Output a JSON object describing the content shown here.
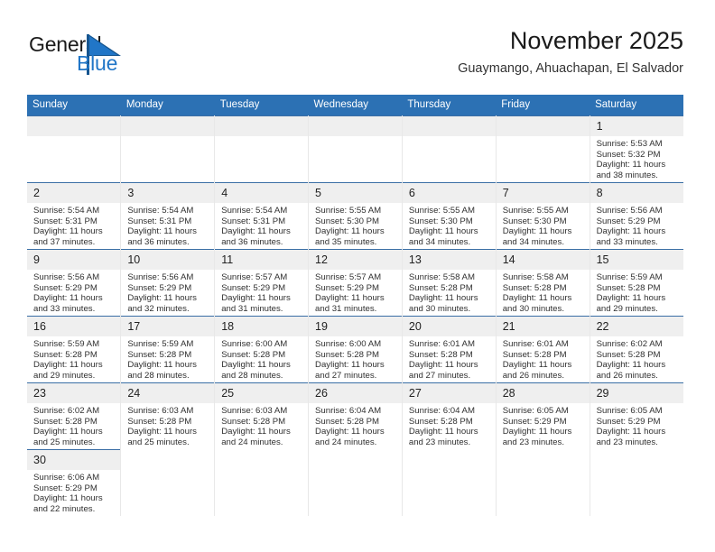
{
  "brand": {
    "name_part1": "General",
    "name_part2": "Blue",
    "logo_icon": "triangle-flag-icon"
  },
  "header": {
    "title": "November 2025",
    "subtitle": "Guaymango, Ahuachapan, El Salvador"
  },
  "colors": {
    "header_blue": "#2c71b4",
    "brand_blue": "#2176c7",
    "row_divider": "#3a6ea5",
    "daynum_band": "#efefef"
  },
  "calendar": {
    "weekday_headers": [
      "Sunday",
      "Monday",
      "Tuesday",
      "Wednesday",
      "Thursday",
      "Friday",
      "Saturday"
    ],
    "labels": {
      "sunrise": "Sunrise:",
      "sunset": "Sunset:",
      "daylight": "Daylight:"
    },
    "weeks": [
      [
        {
          "day": "",
          "empty": true
        },
        {
          "day": "",
          "empty": true
        },
        {
          "day": "",
          "empty": true
        },
        {
          "day": "",
          "empty": true
        },
        {
          "day": "",
          "empty": true
        },
        {
          "day": "",
          "empty": true
        },
        {
          "day": "1",
          "sunrise": "Sunrise: 5:53 AM",
          "sunset": "Sunset: 5:32 PM",
          "daylight": "Daylight: 11 hours and 38 minutes."
        }
      ],
      [
        {
          "day": "2",
          "sunrise": "Sunrise: 5:54 AM",
          "sunset": "Sunset: 5:31 PM",
          "daylight": "Daylight: 11 hours and 37 minutes."
        },
        {
          "day": "3",
          "sunrise": "Sunrise: 5:54 AM",
          "sunset": "Sunset: 5:31 PM",
          "daylight": "Daylight: 11 hours and 36 minutes."
        },
        {
          "day": "4",
          "sunrise": "Sunrise: 5:54 AM",
          "sunset": "Sunset: 5:31 PM",
          "daylight": "Daylight: 11 hours and 36 minutes."
        },
        {
          "day": "5",
          "sunrise": "Sunrise: 5:55 AM",
          "sunset": "Sunset: 5:30 PM",
          "daylight": "Daylight: 11 hours and 35 minutes."
        },
        {
          "day": "6",
          "sunrise": "Sunrise: 5:55 AM",
          "sunset": "Sunset: 5:30 PM",
          "daylight": "Daylight: 11 hours and 34 minutes."
        },
        {
          "day": "7",
          "sunrise": "Sunrise: 5:55 AM",
          "sunset": "Sunset: 5:30 PM",
          "daylight": "Daylight: 11 hours and 34 minutes."
        },
        {
          "day": "8",
          "sunrise": "Sunrise: 5:56 AM",
          "sunset": "Sunset: 5:29 PM",
          "daylight": "Daylight: 11 hours and 33 minutes."
        }
      ],
      [
        {
          "day": "9",
          "sunrise": "Sunrise: 5:56 AM",
          "sunset": "Sunset: 5:29 PM",
          "daylight": "Daylight: 11 hours and 33 minutes."
        },
        {
          "day": "10",
          "sunrise": "Sunrise: 5:56 AM",
          "sunset": "Sunset: 5:29 PM",
          "daylight": "Daylight: 11 hours and 32 minutes."
        },
        {
          "day": "11",
          "sunrise": "Sunrise: 5:57 AM",
          "sunset": "Sunset: 5:29 PM",
          "daylight": "Daylight: 11 hours and 31 minutes."
        },
        {
          "day": "12",
          "sunrise": "Sunrise: 5:57 AM",
          "sunset": "Sunset: 5:29 PM",
          "daylight": "Daylight: 11 hours and 31 minutes."
        },
        {
          "day": "13",
          "sunrise": "Sunrise: 5:58 AM",
          "sunset": "Sunset: 5:28 PM",
          "daylight": "Daylight: 11 hours and 30 minutes."
        },
        {
          "day": "14",
          "sunrise": "Sunrise: 5:58 AM",
          "sunset": "Sunset: 5:28 PM",
          "daylight": "Daylight: 11 hours and 30 minutes."
        },
        {
          "day": "15",
          "sunrise": "Sunrise: 5:59 AM",
          "sunset": "Sunset: 5:28 PM",
          "daylight": "Daylight: 11 hours and 29 minutes."
        }
      ],
      [
        {
          "day": "16",
          "sunrise": "Sunrise: 5:59 AM",
          "sunset": "Sunset: 5:28 PM",
          "daylight": "Daylight: 11 hours and 29 minutes."
        },
        {
          "day": "17",
          "sunrise": "Sunrise: 5:59 AM",
          "sunset": "Sunset: 5:28 PM",
          "daylight": "Daylight: 11 hours and 28 minutes."
        },
        {
          "day": "18",
          "sunrise": "Sunrise: 6:00 AM",
          "sunset": "Sunset: 5:28 PM",
          "daylight": "Daylight: 11 hours and 28 minutes."
        },
        {
          "day": "19",
          "sunrise": "Sunrise: 6:00 AM",
          "sunset": "Sunset: 5:28 PM",
          "daylight": "Daylight: 11 hours and 27 minutes."
        },
        {
          "day": "20",
          "sunrise": "Sunrise: 6:01 AM",
          "sunset": "Sunset: 5:28 PM",
          "daylight": "Daylight: 11 hours and 27 minutes."
        },
        {
          "day": "21",
          "sunrise": "Sunrise: 6:01 AM",
          "sunset": "Sunset: 5:28 PM",
          "daylight": "Daylight: 11 hours and 26 minutes."
        },
        {
          "day": "22",
          "sunrise": "Sunrise: 6:02 AM",
          "sunset": "Sunset: 5:28 PM",
          "daylight": "Daylight: 11 hours and 26 minutes."
        }
      ],
      [
        {
          "day": "23",
          "sunrise": "Sunrise: 6:02 AM",
          "sunset": "Sunset: 5:28 PM",
          "daylight": "Daylight: 11 hours and 25 minutes."
        },
        {
          "day": "24",
          "sunrise": "Sunrise: 6:03 AM",
          "sunset": "Sunset: 5:28 PM",
          "daylight": "Daylight: 11 hours and 25 minutes."
        },
        {
          "day": "25",
          "sunrise": "Sunrise: 6:03 AM",
          "sunset": "Sunset: 5:28 PM",
          "daylight": "Daylight: 11 hours and 24 minutes."
        },
        {
          "day": "26",
          "sunrise": "Sunrise: 6:04 AM",
          "sunset": "Sunset: 5:28 PM",
          "daylight": "Daylight: 11 hours and 24 minutes."
        },
        {
          "day": "27",
          "sunrise": "Sunrise: 6:04 AM",
          "sunset": "Sunset: 5:28 PM",
          "daylight": "Daylight: 11 hours and 23 minutes."
        },
        {
          "day": "28",
          "sunrise": "Sunrise: 6:05 AM",
          "sunset": "Sunset: 5:29 PM",
          "daylight": "Daylight: 11 hours and 23 minutes."
        },
        {
          "day": "29",
          "sunrise": "Sunrise: 6:05 AM",
          "sunset": "Sunset: 5:29 PM",
          "daylight": "Daylight: 11 hours and 23 minutes."
        }
      ],
      [
        {
          "day": "30",
          "sunrise": "Sunrise: 6:06 AM",
          "sunset": "Sunset: 5:29 PM",
          "daylight": "Daylight: 11 hours and 22 minutes."
        },
        {
          "day": "",
          "empty": true,
          "blank": true
        },
        {
          "day": "",
          "empty": true,
          "blank": true
        },
        {
          "day": "",
          "empty": true,
          "blank": true
        },
        {
          "day": "",
          "empty": true,
          "blank": true
        },
        {
          "day": "",
          "empty": true,
          "blank": true
        },
        {
          "day": "",
          "empty": true,
          "blank": true
        }
      ]
    ]
  }
}
